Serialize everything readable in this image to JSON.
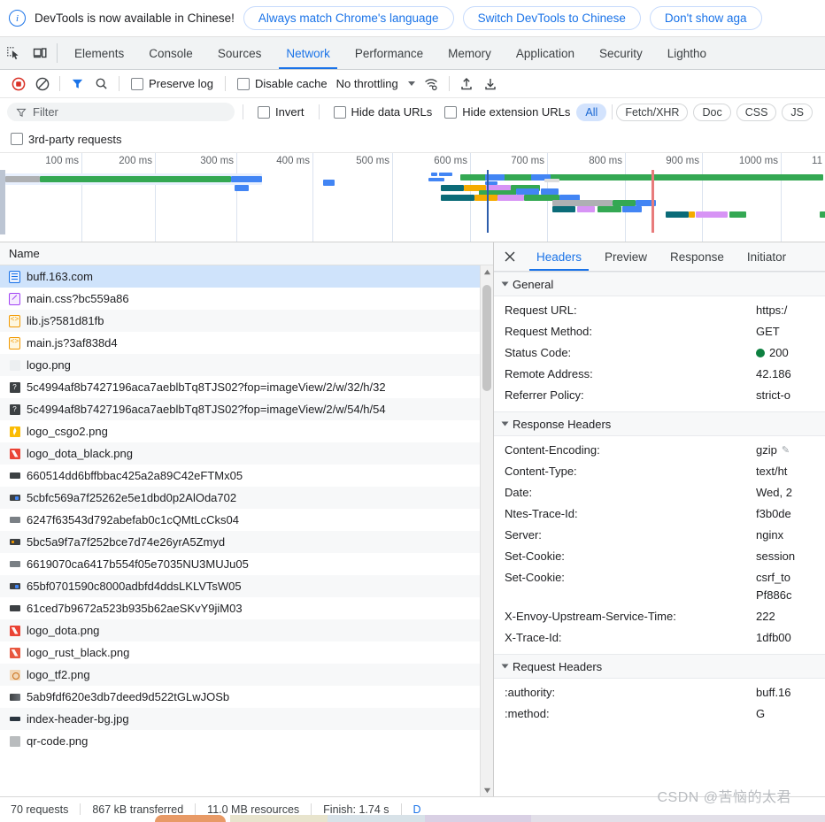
{
  "infobar": {
    "icon": "info-icon",
    "message": "DevTools is now available in Chinese!",
    "buttons": [
      "Always match Chrome's language",
      "Switch DevTools to Chinese",
      "Don't show aga"
    ]
  },
  "tabstrip": {
    "icons": [
      "inspect-cursor-icon",
      "device-toggle-icon"
    ],
    "tabs": [
      {
        "label": "Elements",
        "active": false
      },
      {
        "label": "Console",
        "active": false
      },
      {
        "label": "Sources",
        "active": false
      },
      {
        "label": "Network",
        "active": true
      },
      {
        "label": "Performance",
        "active": false
      },
      {
        "label": "Memory",
        "active": false
      },
      {
        "label": "Application",
        "active": false
      },
      {
        "label": "Security",
        "active": false
      },
      {
        "label": "Lightho",
        "active": false
      }
    ]
  },
  "network_toolbar": {
    "record_label": "record-button",
    "clear_label": "clear-button",
    "filter_label": "filter-toggle",
    "search_label": "search-button",
    "preserve_log": "Preserve log",
    "disable_cache": "Disable cache",
    "throttling": "No throttling",
    "wifi_label": "network-conditions",
    "import_label": "import-har",
    "export_label": "export-har"
  },
  "filterbar": {
    "placeholder": "Filter",
    "invert": "Invert",
    "hide_data_urls": "Hide data URLs",
    "hide_extension_urls": "Hide extension URLs",
    "types": [
      {
        "label": "All",
        "selected": true
      },
      {
        "label": "Fetch/XHR",
        "selected": false
      },
      {
        "label": "Doc",
        "selected": false
      },
      {
        "label": "CSS",
        "selected": false
      },
      {
        "label": "JS",
        "selected": false
      }
    ],
    "third_party": "3rd-party requests"
  },
  "overview": {
    "ticks": [
      "100 ms",
      "200 ms",
      "300 ms",
      "400 ms",
      "500 ms",
      "600 ms",
      "700 ms",
      "800 ms",
      "900 ms",
      "1000 ms",
      "11"
    ],
    "dom_content_loaded_color": "#2d5dab",
    "load_event_color": "#e87b7b"
  },
  "requests": {
    "column_header": "Name",
    "rows": [
      {
        "name": "buff.163.com",
        "icon": "doc-icon",
        "selected": true
      },
      {
        "name": "main.css?bc559a86",
        "icon": "css-icon",
        "selected": false
      },
      {
        "name": "lib.js?581d81fb",
        "icon": "js-icon",
        "selected": false
      },
      {
        "name": "main.js?3af838d4",
        "icon": "js-icon",
        "selected": false
      },
      {
        "name": "logo.png",
        "icon": "image-blank-icon",
        "selected": false
      },
      {
        "name": "5c4994af8b7427196aca7aeblbTq8TJS02?fop=imageView/2/w/32/h/32",
        "icon": "image-unknown-icon",
        "selected": false
      },
      {
        "name": "5c4994af8b7427196aca7aeblbTq8TJS02?fop=imageView/2/w/54/h/54",
        "icon": "image-unknown-icon",
        "selected": false
      },
      {
        "name": "logo_csgo2.png",
        "icon": "image-csgo-icon",
        "selected": false
      },
      {
        "name": "logo_dota_black.png",
        "icon": "image-dota-icon",
        "selected": false
      },
      {
        "name": "660514dd6bffbbac425a2a89C42eFTMx05",
        "icon": "image-strip-icon",
        "selected": false
      },
      {
        "name": "5cbfc569a7f25262e5e1dbd0p2AlOda702",
        "icon": "image-strip-blue-icon",
        "selected": false
      },
      {
        "name": "6247f63543d792abefab0c1cQMtLcCks04",
        "icon": "image-strip-icon",
        "selected": false
      },
      {
        "name": "5bc5a9f7a7f252bce7d74e26yrA5Zmyd",
        "icon": "image-strip-orange-icon",
        "selected": false
      },
      {
        "name": "6619070ca6417b554f05e7035NU3MUJu05",
        "icon": "image-strip-icon",
        "selected": false
      },
      {
        "name": "65bf0701590c8000adbfd4ddsLKLVTsW05",
        "icon": "image-strip-blue-icon",
        "selected": false
      },
      {
        "name": "61ced7b9672a523b935b62aeSKvY9jiM03",
        "icon": "image-strip-icon",
        "selected": false
      },
      {
        "name": "logo_dota.png",
        "icon": "image-dota-icon",
        "selected": false
      },
      {
        "name": "logo_rust_black.png",
        "icon": "image-rust-icon",
        "selected": false
      },
      {
        "name": "logo_tf2.png",
        "icon": "image-tf2-icon",
        "selected": false
      },
      {
        "name": "5ab9fdf620e3db7deed9d522tGLwJOSb",
        "icon": "image-gradient-icon",
        "selected": false
      },
      {
        "name": "index-header-bg.jpg",
        "icon": "image-strip-icon",
        "selected": false
      },
      {
        "name": "qr-code.png",
        "icon": "image-qr-icon",
        "selected": false
      }
    ]
  },
  "details": {
    "close_label": "close-icon",
    "tabs": [
      {
        "label": "Headers",
        "active": true
      },
      {
        "label": "Preview",
        "active": false
      },
      {
        "label": "Response",
        "active": false
      },
      {
        "label": "Initiator",
        "active": false
      }
    ],
    "sections": [
      {
        "title": "General",
        "rows": [
          {
            "name": "Request URL:",
            "value": "https:/",
            "status": false
          },
          {
            "name": "Request Method:",
            "value": "GET",
            "status": false
          },
          {
            "name": "Status Code:",
            "value": "200",
            "status": true
          },
          {
            "name": "Remote Address:",
            "value": "42.186",
            "status": false
          },
          {
            "name": "Referrer Policy:",
            "value": "strict-o",
            "status": false
          }
        ]
      },
      {
        "title": "Response Headers",
        "rows": [
          {
            "name": "Content-Encoding:",
            "value": "gzip",
            "status": false,
            "edit": true
          },
          {
            "name": "Content-Type:",
            "value": "text/ht",
            "status": false
          },
          {
            "name": "Date:",
            "value": "Wed, 2",
            "status": false
          },
          {
            "name": "Ntes-Trace-Id:",
            "value": "f3b0de",
            "status": false
          },
          {
            "name": "Server:",
            "value": "nginx",
            "status": false
          },
          {
            "name": "Set-Cookie:",
            "value": "session",
            "status": false
          },
          {
            "name": "Set-Cookie:",
            "value": "csrf_to",
            "status": false,
            "value2": "Pf886c"
          },
          {
            "name": "X-Envoy-Upstream-Service-Time:",
            "value": "222",
            "status": false
          },
          {
            "name": "X-Trace-Id:",
            "value": "1dfb00",
            "status": false
          }
        ]
      },
      {
        "title": "Request Headers",
        "rows": [
          {
            "name": ":authority:",
            "value": "buff.16",
            "status": false
          },
          {
            "name": ":method:",
            "value": "G",
            "status": false
          }
        ]
      }
    ]
  },
  "statusbar": {
    "requests": "70 requests",
    "transferred": "867 kB transferred",
    "resources": "11.0 MB resources",
    "finish": "Finish: 1.74 s",
    "extra": "D"
  },
  "watermark": "CSDN @苦恼的太君",
  "colors": {
    "accent": "#1a73e8",
    "selected_row": "#cfe3fb",
    "record_red": "#d93025",
    "status_green": "#0d8040",
    "timeline_green": "#34a853",
    "timeline_blue": "#4285f4",
    "timeline_gray": "#aeb0b3",
    "timeline_purple": "#d794f5",
    "timeline_orange": "#f5ab00",
    "timeline_teal": "#0b6b78"
  }
}
